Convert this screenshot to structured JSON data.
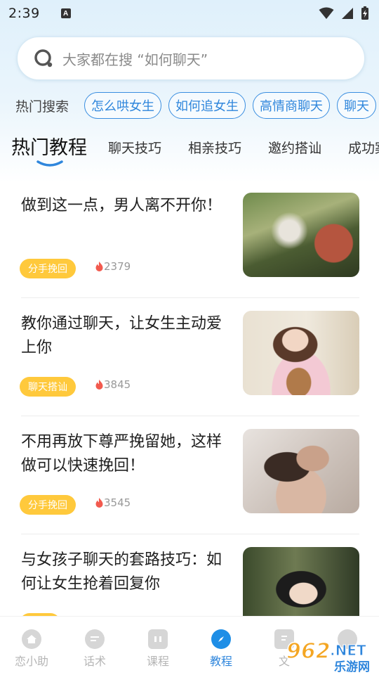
{
  "status_bar": {
    "time": "2:39",
    "notification_glyph": "A"
  },
  "search": {
    "placeholder": "大家都在搜 “如何聊天”"
  },
  "hot_search": {
    "label": "热门搜索",
    "chips": [
      "怎么哄女生",
      "如何追女生",
      "高情商聊天",
      "聊天"
    ]
  },
  "tabs": [
    {
      "label": "热门教程",
      "active": true
    },
    {
      "label": "聊天技巧",
      "active": false
    },
    {
      "label": "相亲技巧",
      "active": false
    },
    {
      "label": "邀约搭讪",
      "active": false
    },
    {
      "label": "成功案",
      "active": false
    }
  ],
  "articles": [
    {
      "title": "做到这一点，男人离不开你！",
      "tag": "分手挽回",
      "views": "2379",
      "thumb": "woman-in-greenhouse-photo"
    },
    {
      "title": "教你通过聊天，让女生主动爱上你",
      "tag": "聊天搭讪",
      "views": "3845",
      "thumb": "girl-with-teddy-bear-photo"
    },
    {
      "title": "不用再放下尊严挽留她，这样做可以快速挽回！",
      "tag": "分手挽回",
      "views": "3545",
      "thumb": "couple-embrace-photo"
    },
    {
      "title": "与女孩子聊天的套路技巧：如何让女生抢着回复你",
      "tag": "",
      "views": "",
      "thumb": "schoolgirl-portrait-photo"
    }
  ],
  "bottom_nav": [
    {
      "label": "恋小助",
      "icon": "home-icon",
      "active": false
    },
    {
      "label": "话术",
      "icon": "chat-icon",
      "active": false
    },
    {
      "label": "课程",
      "icon": "course-icon",
      "active": false
    },
    {
      "label": "教程",
      "icon": "compass-icon",
      "active": true
    },
    {
      "label": "文",
      "icon": "article-icon",
      "active": false
    },
    {
      "label": "",
      "icon": "profile-icon",
      "active": false
    }
  ],
  "watermark": {
    "brand_number": "962",
    "brand_suffix": ".NET",
    "brand_sub": "乐游网"
  },
  "colors": {
    "accent": "#2f86dc",
    "tag_yellow": "#ffc93c",
    "fire_red": "#f25a4e"
  }
}
